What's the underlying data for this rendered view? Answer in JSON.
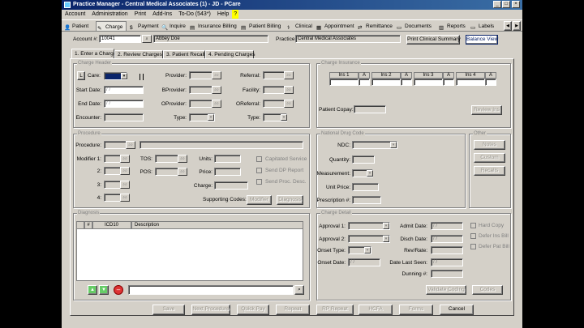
{
  "window": {
    "title": "Practice Manager - Central Medical Associates (1) - JD - PCare"
  },
  "menu": [
    "Account",
    "Administration",
    "Print",
    "Add-Ins",
    "To-Do (543*)",
    "Help"
  ],
  "toolbar": [
    "Patient",
    "Charge",
    "Payment",
    "Inquire",
    "Insurance Billing",
    "Patient Billing",
    "Clinical",
    "Appointment",
    "Remittance",
    "Documents",
    "Reports",
    "Labels"
  ],
  "account": {
    "label": "Account #:",
    "value": "10041",
    "patient": "Abbey Doe",
    "practice_label": "Practice:",
    "practice": "Central Medical Associates",
    "print_summary": "Print Clinical Summary",
    "balance_view": "Balance View"
  },
  "tabs": [
    "1. Enter a Charge",
    "2. Review Charges",
    "3. Patient Recall",
    "4. Pending Charges"
  ],
  "charge_header": {
    "title": "Charge Header",
    "l_btn": "L",
    "care": "Care:",
    "start": "Start Date:",
    "start_val": "/ /",
    "end": "End Date:",
    "end_val": "/ /",
    "encounter": "Encounter:",
    "provider": "Provider:",
    "bprovider": "BProvider:",
    "oprovider": "OProvider:",
    "type": "Type:",
    "referral": "Referral:",
    "facility": "Facility:",
    "oreferral": "OReferral:",
    "type2": "Type:"
  },
  "charge_insurance": {
    "title": "Charge Insurance",
    "cols": [
      "Ins 1",
      "A",
      "Ins 2",
      "A",
      "Ins 3",
      "A",
      "Ins 4",
      "A"
    ],
    "copay": "Patient Copay:",
    "review": "Review Ins"
  },
  "procedure": {
    "title": "Procedure",
    "procedure": "Procedure:",
    "modifier": "Modifier 1:",
    "m2": "2:",
    "m3": "3:",
    "m4": "4:",
    "tos": "TOS:",
    "pos": "POS:",
    "units": "Units:",
    "price": "Price:",
    "charge": "Charge:",
    "cap": "Capitated Service",
    "send_dp": "Send DP Report",
    "send_proc": "Send Proc. Desc.",
    "supporting": "Supporting Codes:",
    "modifier_btn": "Modifier",
    "diagnosis_btn": "Diagnosis"
  },
  "ndc": {
    "title": "National Drug Code",
    "ndc": "NDC:",
    "quantity": "Quantity:",
    "measurement": "Measurement:",
    "unit_price": "Unit Price:",
    "rx": "Prescription #:"
  },
  "other": {
    "title": "Other",
    "notes": "Notes",
    "custom": "Custom",
    "recalls": "Recalls"
  },
  "diagnosis": {
    "title": "Diagnosis",
    "cols": [
      "#",
      "ICD10",
      "Description"
    ]
  },
  "detail": {
    "title": "Charge Detail",
    "approval1": "Approval 1:",
    "approval2": "Approval 2:",
    "onset_type": "Onset Type:",
    "onset_date": "Onset Date:",
    "onset_val": "/ /",
    "admit": "Admit Date:",
    "admit_val": "/ /",
    "disch": "Disch Date:",
    "disch_val": "/ /",
    "rev": "Rev/Rate:",
    "last_seen": "Date Last Seen:",
    "last_val": "/ /",
    "dunning": "Dunning #:",
    "hard_copy": "Hard Copy",
    "defer_ins": "Defer Ins Bill",
    "defer_pat": "Defer Pat Bill",
    "validate": "Validate Coding",
    "codes": "Codes"
  },
  "footer": [
    "Save",
    "Next Procedure",
    "Quick Pay",
    "Repeat",
    "RP Repeat",
    "HCFA",
    "Forms",
    "Cancel"
  ]
}
